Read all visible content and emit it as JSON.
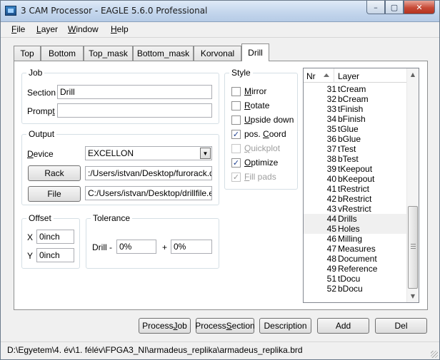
{
  "window": {
    "title": "3 CAM Processor - EAGLE 5.6.0 Professional",
    "min_glyph": "–",
    "max_glyph": "▢",
    "close_glyph": "✕"
  },
  "menu": [
    {
      "accel": "F",
      "rest": "ile"
    },
    {
      "accel": "L",
      "rest": "ayer"
    },
    {
      "accel": "W",
      "rest": "indow"
    },
    {
      "accel": "H",
      "rest": "elp"
    }
  ],
  "tabs": [
    "Top",
    "Bottom",
    "Top_mask",
    "Bottom_mask",
    "Korvonal",
    "Drill"
  ],
  "active_tab": "Drill",
  "job": {
    "group_label": "Job",
    "section_label": "Section",
    "section_value": "Drill",
    "prompt_label_pre": "Promp",
    "prompt_label_accel": "t",
    "prompt_value": ""
  },
  "output": {
    "group_label": "Output",
    "device_accel": "D",
    "device_rest": "evice",
    "device_value": "EXCELLON",
    "rack_button": "Rack",
    "rack_value": ":/Users/istvan/Desktop/furorack.drl",
    "file_button": "File",
    "file_value": "C:/Users/istvan/Desktop/drillfile.exc"
  },
  "offset": {
    "group_label": "Offset",
    "x_label": "X",
    "x_value": "0inch",
    "y_label": "Y",
    "y_value": "0inch"
  },
  "tolerance": {
    "group_label": "Tolerance",
    "drill_label": "Drill",
    "minus": "-",
    "minus_value": "0%",
    "plus": "+",
    "plus_value": "0%"
  },
  "style": {
    "group_label": "Style",
    "options": [
      {
        "accel": "M",
        "rest": "irror",
        "checked": false,
        "enabled": true
      },
      {
        "accel": "R",
        "rest": "otate",
        "checked": false,
        "enabled": true
      },
      {
        "accel": "U",
        "rest": "pside down",
        "checked": false,
        "enabled": true
      },
      {
        "pre": "pos. ",
        "accel": "C",
        "rest": "oord",
        "checked": true,
        "enabled": true
      },
      {
        "accel": "Q",
        "rest": "uickplot",
        "checked": false,
        "enabled": false
      },
      {
        "accel": "O",
        "rest": "ptimize",
        "checked": true,
        "enabled": true
      },
      {
        "accel": "F",
        "rest": "ill pads",
        "checked": true,
        "enabled": false
      }
    ]
  },
  "layers": {
    "col_nr": "Nr",
    "col_layer": "Layer",
    "rows": [
      {
        "nr": "31",
        "name": "tCream",
        "selected": false
      },
      {
        "nr": "32",
        "name": "bCream",
        "selected": false
      },
      {
        "nr": "33",
        "name": "tFinish",
        "selected": false
      },
      {
        "nr": "34",
        "name": "bFinish",
        "selected": false
      },
      {
        "nr": "35",
        "name": "tGlue",
        "selected": false
      },
      {
        "nr": "36",
        "name": "bGlue",
        "selected": false
      },
      {
        "nr": "37",
        "name": "tTest",
        "selected": false
      },
      {
        "nr": "38",
        "name": "bTest",
        "selected": false
      },
      {
        "nr": "39",
        "name": "tKeepout",
        "selected": false
      },
      {
        "nr": "40",
        "name": "bKeepout",
        "selected": false
      },
      {
        "nr": "41",
        "name": "tRestrict",
        "selected": false
      },
      {
        "nr": "42",
        "name": "bRestrict",
        "selected": false
      },
      {
        "nr": "43",
        "name": "vRestrict",
        "selected": false
      },
      {
        "nr": "44",
        "name": "Drills",
        "selected": true
      },
      {
        "nr": "45",
        "name": "Holes",
        "selected": true
      },
      {
        "nr": "46",
        "name": "Milling",
        "selected": false
      },
      {
        "nr": "47",
        "name": "Measures",
        "selected": false
      },
      {
        "nr": "48",
        "name": "Document",
        "selected": false
      },
      {
        "nr": "49",
        "name": "Reference",
        "selected": false
      },
      {
        "nr": "51",
        "name": "tDocu",
        "selected": false
      },
      {
        "nr": "52",
        "name": "bDocu",
        "selected": false
      }
    ]
  },
  "buttons": {
    "process_job_pre": "Process ",
    "process_job_accel": "J",
    "process_job_rest": "ob",
    "process_section_pre": "Process ",
    "process_section_accel": "S",
    "process_section_rest": "ection",
    "description": "Description",
    "add": "Add",
    "del": "Del"
  },
  "status": {
    "path": "D:\\Egyetem\\4. év\\1. félév\\FPGA3_NI\\armadeus_replika\\armadeus_replika.brd"
  }
}
